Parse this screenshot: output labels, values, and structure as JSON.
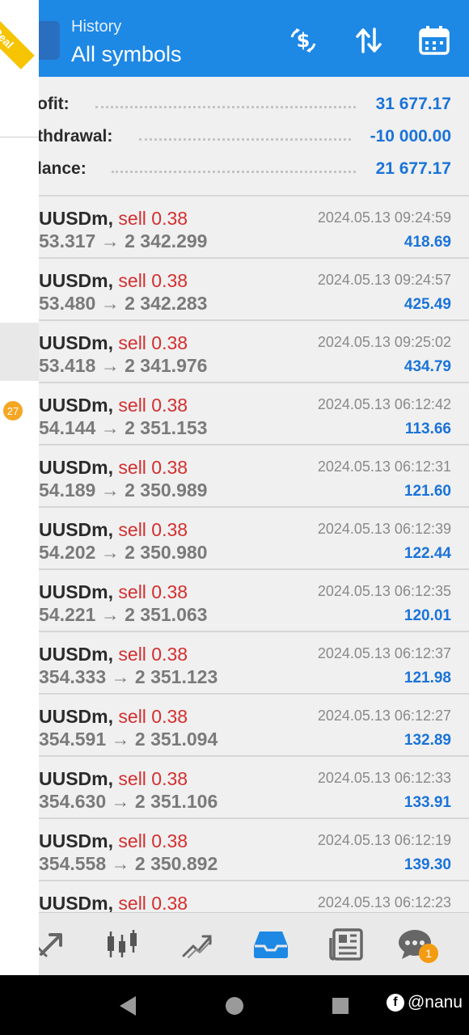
{
  "header": {
    "subtitle": "History",
    "title": "All symbols",
    "icons": [
      "currency-exchange-icon",
      "sort-icon",
      "calendar-icon"
    ]
  },
  "summary": {
    "profit_label": "ofit:",
    "profit_value": "31 677.17",
    "withdrawal_label": "thdrawal:",
    "withdrawal_value": "-10 000.00",
    "balance_label": "lance:",
    "balance_value": "21 677.17"
  },
  "deals": [
    {
      "symbol": "UUSDm,",
      "side": "sell 0.38",
      "prices": "53.317 → 2 342.299",
      "time": "2024.05.13 09:24:59",
      "profit": "418.69"
    },
    {
      "symbol": "UUSDm,",
      "side": "sell 0.38",
      "prices": "53.480 → 2 342.283",
      "time": "2024.05.13 09:24:57",
      "profit": "425.49"
    },
    {
      "symbol": "UUSDm,",
      "side": "sell 0.38",
      "prices": "53.418 → 2 341.976",
      "time": "2024.05.13 09:25:02",
      "profit": "434.79"
    },
    {
      "symbol": "UUSDm,",
      "side": "sell 0.38",
      "prices": "54.144 → 2 351.153",
      "time": "2024.05.13 06:12:42",
      "profit": "113.66"
    },
    {
      "symbol": "UUSDm,",
      "side": "sell 0.38",
      "prices": "54.189 → 2 350.989",
      "time": "2024.05.13 06:12:31",
      "profit": "121.60"
    },
    {
      "symbol": "UUSDm,",
      "side": "sell 0.38",
      "prices": "54.202 → 2 350.980",
      "time": "2024.05.13 06:12:39",
      "profit": "122.44"
    },
    {
      "symbol": "UUSDm,",
      "side": "sell 0.38",
      "prices": "54.221 → 2 351.063",
      "time": "2024.05.13 06:12:35",
      "profit": "120.01"
    },
    {
      "symbol": "UUSDm,",
      "side": "sell 0.38",
      "prices": "354.333 → 2 351.123",
      "time": "2024.05.13 06:12:37",
      "profit": "121.98"
    },
    {
      "symbol": "UUSDm,",
      "side": "sell 0.38",
      "prices": "354.591 → 2 351.094",
      "time": "2024.05.13 06:12:27",
      "profit": "132.89"
    },
    {
      "symbol": "UUSDm,",
      "side": "sell 0.38",
      "prices": "354.630 → 2 351.106",
      "time": "2024.05.13 06:12:33",
      "profit": "133.91"
    },
    {
      "symbol": "UUSDm,",
      "side": "sell 0.38",
      "prices": "354.558 → 2 350.892",
      "time": "2024.05.13 06:12:19",
      "profit": "139.30"
    },
    {
      "symbol": "UUSDm,",
      "side": "sell 0.38",
      "prices": "",
      "time": "2024.05.13 06:12:23",
      "profit": ""
    }
  ],
  "bottom_nav": {
    "items": [
      "quotes-icon",
      "chart-icon",
      "trade-icon",
      "history-icon",
      "news-icon",
      "chat-icon"
    ],
    "active": "history-icon",
    "chat_badge": "1"
  },
  "drawer": {
    "account_ribbon": "Real",
    "count_badge": "27"
  },
  "watermark": {
    "text": "@nanu"
  },
  "colors": {
    "header": "#1e88e5",
    "profit": "#1a73d9",
    "sell": "#d32f2f"
  }
}
